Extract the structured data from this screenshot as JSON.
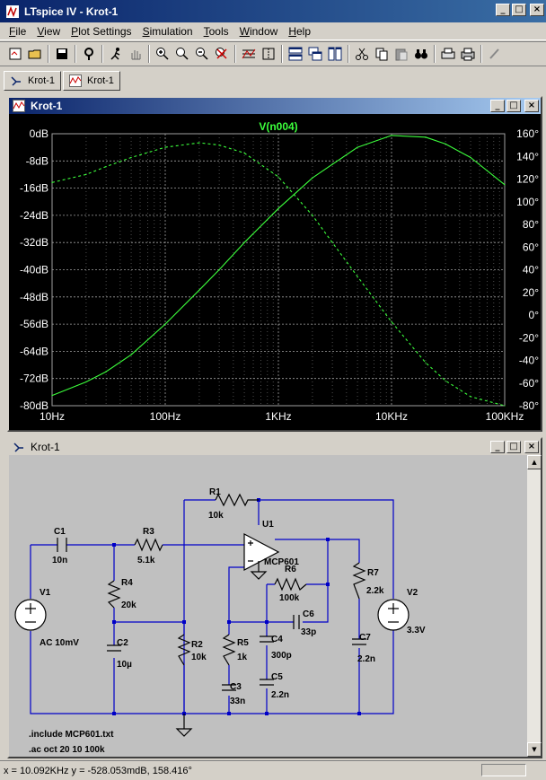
{
  "app": {
    "title": "LTspice IV - Krot-1"
  },
  "window_controls": {
    "minimize": "_",
    "maximize": "□",
    "close": "×"
  },
  "menu": [
    {
      "label": "File",
      "key": "F",
      "rest": "ile"
    },
    {
      "label": "View",
      "key": "V",
      "rest": "iew"
    },
    {
      "label": "Plot Settings",
      "key": "P",
      "rest": "lot Settings"
    },
    {
      "label": "Simulation",
      "key": "S",
      "rest": "imulation"
    },
    {
      "label": "Tools",
      "key": "T",
      "rest": "ools"
    },
    {
      "label": "Window",
      "key": "W",
      "rest": "indow"
    },
    {
      "label": "Help",
      "key": "H",
      "rest": "elp"
    }
  ],
  "toolbar_icons": [
    "new-schematic-icon",
    "open-icon",
    "save-icon",
    "control-panel-icon",
    "run-icon",
    "pan-icon",
    "zoom-in-icon",
    "zoom-area-icon",
    "zoom-out-icon",
    "zoom-fit-icon",
    "autorange-icon",
    "cursor-icon",
    "tile-horizontal-icon",
    "cascade-icon",
    "tile-vertical-icon",
    "cut-icon",
    "copy-icon",
    "paste-icon",
    "find-icon",
    "print-preview-icon",
    "print-icon",
    "draw-wire-icon"
  ],
  "tabs": [
    {
      "label": "Krot-1",
      "icon": "schematic-icon"
    },
    {
      "label": "Krot-1",
      "icon": "waveform-icon"
    }
  ],
  "plot_window": {
    "title": "Krot-1"
  },
  "schematic_window": {
    "title": "Krot-1"
  },
  "chart_data": {
    "type": "line",
    "title": "V(n004)",
    "x_scale": "log",
    "x_ticks": [
      "10Hz",
      "100Hz",
      "1KHz",
      "10KHz",
      "100KHz"
    ],
    "y_left_ticks": [
      "0dB",
      "-8dB",
      "-16dB",
      "-24dB",
      "-32dB",
      "-40dB",
      "-48dB",
      "-56dB",
      "-64dB",
      "-72dB",
      "-80dB"
    ],
    "y_right_ticks": [
      "160°",
      "140°",
      "120°",
      "100°",
      "80°",
      "60°",
      "40°",
      "20°",
      "0°",
      "-20°",
      "-40°",
      "-60°",
      "-80°"
    ],
    "ylim_left": [
      -80,
      0
    ],
    "ylim_right": [
      -80,
      160
    ],
    "xlim": [
      10,
      100000
    ],
    "colors": {
      "background": "#000000",
      "trace": "#3cff3c",
      "grid": "#a0a0a0",
      "text": "#ffffff"
    },
    "series": [
      {
        "axis": "left",
        "style": "solid",
        "x": [
          10,
          20,
          30,
          50,
          100,
          200,
          300,
          500,
          1000,
          2000,
          3000,
          5000,
          10000,
          20000,
          30000,
          50000,
          100000
        ],
        "y": [
          -77,
          -73,
          -70,
          -65,
          -56,
          -46,
          -40,
          -32,
          -22,
          -13,
          -9,
          -4,
          -0.5,
          -1,
          -3,
          -7,
          -15
        ]
      },
      {
        "axis": "right",
        "style": "dashed",
        "x": [
          10,
          20,
          30,
          50,
          100,
          200,
          300,
          500,
          1000,
          2000,
          3000,
          5000,
          10000,
          20000,
          30000,
          50000,
          100000
        ],
        "y": [
          117,
          124,
          131,
          139,
          148,
          152,
          150,
          143,
          122,
          88,
          64,
          34,
          -6,
          -42,
          -58,
          -72,
          -80
        ]
      }
    ]
  },
  "schematic": {
    "components": [
      {
        "name": "R1",
        "value": "10k"
      },
      {
        "name": "U1",
        "value": "MCP601"
      },
      {
        "name": "C1",
        "value": "10n"
      },
      {
        "name": "R3",
        "value": "5.1k"
      },
      {
        "name": "R6",
        "value": "100k"
      },
      {
        "name": "R7",
        "value": "2.2k"
      },
      {
        "name": "V2",
        "value": "3.3V"
      },
      {
        "name": "V1",
        "value": "AC 10mV"
      },
      {
        "name": "R4",
        "value": "20k"
      },
      {
        "name": "C6",
        "value": "33p"
      },
      {
        "name": "C2",
        "value": "10µ"
      },
      {
        "name": "R2",
        "value": "10k"
      },
      {
        "name": "R5",
        "value": "1k"
      },
      {
        "name": "C4",
        "value": "300p"
      },
      {
        "name": "C7",
        "value": "2.2n"
      },
      {
        "name": "C3",
        "value": "33n"
      },
      {
        "name": "C5",
        "value": "2.2n"
      }
    ],
    "directives": [
      ".include MCP601.txt",
      ".ac oct 20 10 100k"
    ]
  },
  "status": {
    "cursor": "x = 10.092KHz    y = -528.053mdB, 158.416°"
  },
  "scroll": {
    "up": "▲",
    "down": "▼"
  }
}
